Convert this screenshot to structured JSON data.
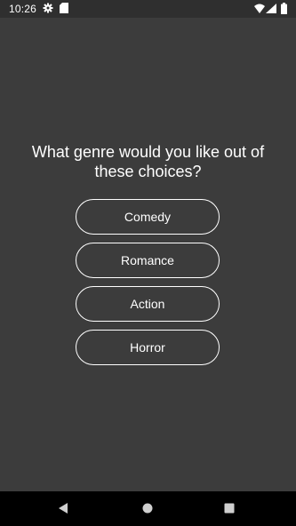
{
  "status_bar": {
    "time": "10:26",
    "icons": [
      "gear-icon",
      "sdcard-icon",
      "wifi-icon",
      "signal-icon",
      "battery-icon"
    ]
  },
  "quiz": {
    "question": "What genre would you like out of these choices?",
    "choices": [
      "Comedy",
      "Romance",
      "Action",
      "Horror"
    ]
  },
  "nav_bar": {
    "icons": [
      "back-icon",
      "home-icon",
      "recents-icon"
    ]
  },
  "colors": {
    "background": "#3c3c3c",
    "status_bar": "#2f2f2f",
    "nav_bar": "#000000",
    "text": "#ffffff",
    "button_border": "#ffffff"
  }
}
